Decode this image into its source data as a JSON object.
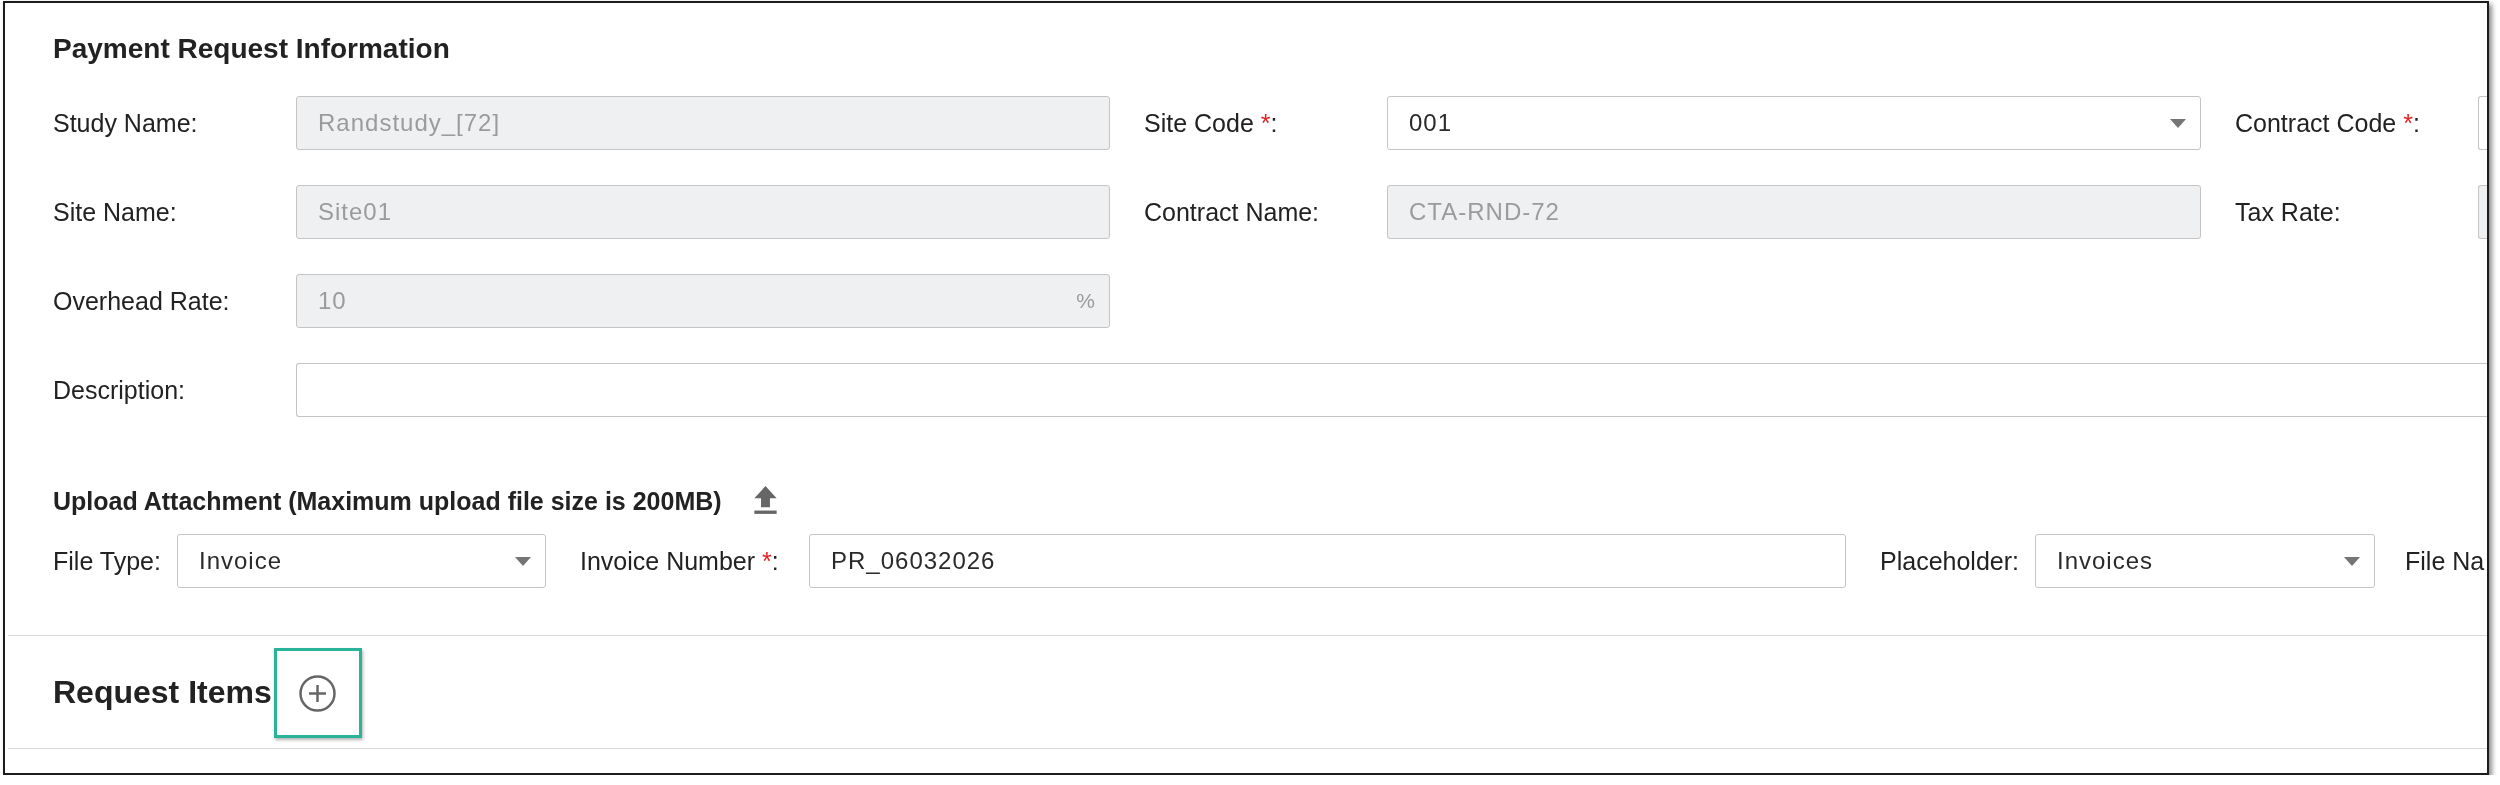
{
  "section": {
    "title": "Payment Request Information"
  },
  "fields": [
    {
      "label": "Study Name:",
      "kind": "text",
      "disabled": true,
      "value": "Randstudy_[72]"
    },
    {
      "label": "Site Code",
      "required_mark": "*",
      "label_end": ":",
      "kind": "select",
      "disabled": false,
      "value": "001"
    },
    {
      "label": "Contract Code",
      "required_mark": "*",
      "label_end": ":",
      "kind": "text"
    },
    {
      "label": "Site Name:",
      "kind": "text",
      "disabled": true,
      "value": "Site01"
    },
    {
      "label": "Contract Name:",
      "kind": "text",
      "disabled": true,
      "value": "CTA-RND-72"
    },
    {
      "label": "Tax Rate:",
      "kind": "text",
      "disabled": true
    },
    {
      "label": "Overhead Rate:",
      "kind": "text",
      "disabled": true,
      "value": "10",
      "unit": "%"
    }
  ],
  "description": {
    "label": "Description:",
    "disabled": false
  },
  "upload": {
    "title": "Upload Attachment (Maximum upload file size is 200MB)",
    "fields": [
      {
        "label": "File Type:",
        "kind": "select",
        "value": "Invoice"
      },
      {
        "label": "Invoice Number",
        "required_mark": "*",
        "label_end": ":",
        "kind": "text",
        "value": "PR_06032026"
      },
      {
        "label": "Placeholder:",
        "kind": "select",
        "value": "Invoices"
      },
      {
        "label": "File Na"
      }
    ]
  },
  "request_items": {
    "title": "Request Items",
    "highlighted": true
  }
}
